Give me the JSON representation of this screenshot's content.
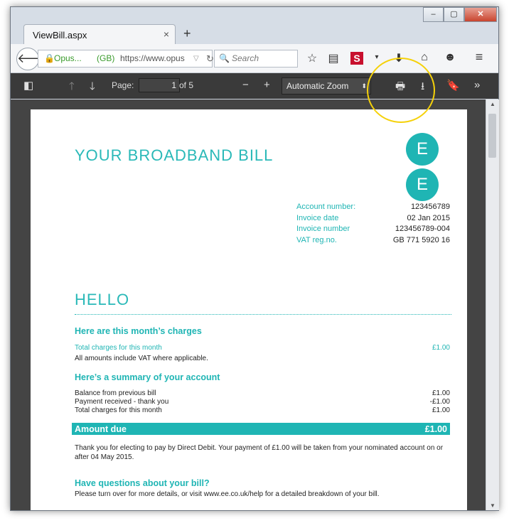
{
  "browser": {
    "tab_title": "ViewBill.aspx",
    "tab_close": "×",
    "new_tab": "+",
    "window_buttons": [
      "–",
      "▢",
      "✕"
    ],
    "identity_name": "Opus...",
    "identity_country": "(GB)",
    "url": "https://www.opus",
    "search_placeholder": "Search"
  },
  "pdf_toolbar": {
    "page_label": "Page:",
    "page_number": "1",
    "page_total": "of 5",
    "zoom_minus": "−",
    "zoom_plus": "+",
    "zoom_value": "Automatic Zoom"
  },
  "bill": {
    "title": "YOUR BROADBAND BILL",
    "logo_letters": [
      "E",
      "E"
    ],
    "account_details": [
      {
        "label": "Account number:",
        "value": "123456789"
      },
      {
        "label": "Invoice date",
        "value": "02 Jan 2015"
      },
      {
        "label": "Invoice number",
        "value": "123456789-004"
      },
      {
        "label": "VAT reg.no.",
        "value": "GB 771 5920 16"
      }
    ],
    "hello": "HELLO",
    "charges_heading": "Here are this month’s charges",
    "total_charges_label": "Total charges for this month",
    "total_charges_value": "£1.00",
    "vat_note": "All amounts include VAT where applicable.",
    "summary_heading": "Here’s a summary of your account",
    "summary_rows": [
      {
        "label": "Balance from previous bill",
        "value": "£1.00"
      },
      {
        "label": "Payment received - thank you",
        "value": "-£1.00"
      },
      {
        "label": "Total charges for this month",
        "value": "£1.00"
      }
    ],
    "amount_due_label": "Amount due",
    "amount_due_value": "£1.00",
    "direct_debit_text": "Thank you for electing to pay by Direct Debit. Your payment of £1.00 will be taken from your nominated account on or after 04 May 2015.",
    "questions_heading": "Have questions about your bill?",
    "questions_text": "Please turn over for more details, or visit www.ee.co.uk/help for a detailed breakdown of your bill."
  },
  "colors": {
    "ee_teal": "#1fb5b4",
    "highlight": "#f5d10a"
  }
}
